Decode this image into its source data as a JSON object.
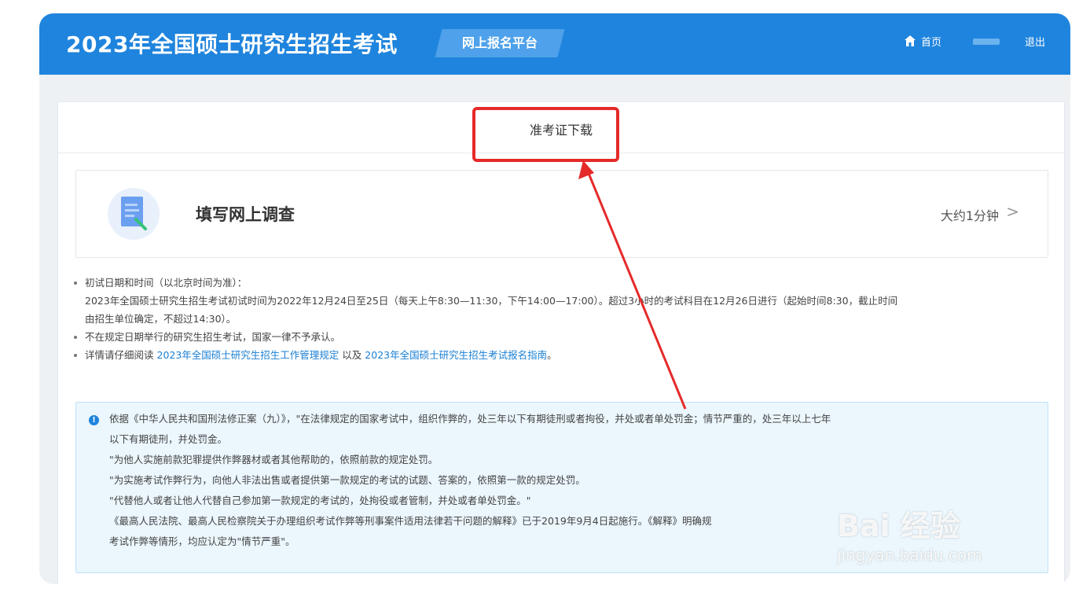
{
  "header": {
    "site_title": "2023年全国硕士研究生招生考试",
    "platform_tag": "网上报名平台",
    "nav": {
      "home_label": "首页",
      "logout_label": "退出"
    },
    "bar_color": "#1f84dd"
  },
  "main": {
    "section_title": "准考证下载",
    "survey": {
      "title": "填写网上调查",
      "duration": "大约1分钟",
      "arrow": ">"
    },
    "notes": {
      "item1_title": "初试日期和时间（以北京时间为准）：",
      "item1_detail_a": "2023年全国硕士研究生招生考试初试时间为2022年12月24日至25日（每天上午8:30—11:30，下午14:00—17:00）。超过3小时的考试科目在12月26日进行（起始时间8:30，截止时间",
      "item1_detail_b": "由招生单位确定，不超过14:30）。",
      "item2": "不在规定日期举行的研究生招生考试，国家一律不予承认。",
      "item3_prefix": "详情请仔细阅读",
      "item3_link1": "2023年全国硕士研究生招生工作管理规定",
      "item3_mid": "以及",
      "item3_link2": "2023年全国硕士研究生招生考试报名指南",
      "item3_suffix": "。"
    },
    "warning": {
      "icon": "!",
      "line1": "依据《中华人民共和国刑法修正案（九）》，\"在法律规定的国家考试中，组织作弊的，处三年以下有期徒刑或者拘役，并处或者单处罚金；情节严重的，处三年以上七年",
      "line2": "以下有期徒刑，并处罚金。",
      "line3": "\"为他人实施前款犯罪提供作弊器材或者其他帮助的，依照前款的规定处罚。",
      "line4": "\"为实施考试作弊行为，向他人非法出售或者提供第一款规定的考试的试题、答案的，依照第一款的规定处罚。",
      "line5": "\"代替他人或者让他人代替自己参加第一款规定的考试的，处拘役或者管制，并处或者单处罚金。\"",
      "line6": "《最高人民法院、最高人民检察院关于办理组织考试作弊等刑事案件适用法律若干问题的解释》已于2019年9月4日起施行。《解释》明确规",
      "line7": "考试作弊等情形，均应认定为\"情节严重\"。"
    }
  },
  "annotation": {
    "color": "#e52a2a"
  },
  "watermark": {
    "main": "Bai 经验",
    "sub": "jingyan.baidu.com"
  }
}
